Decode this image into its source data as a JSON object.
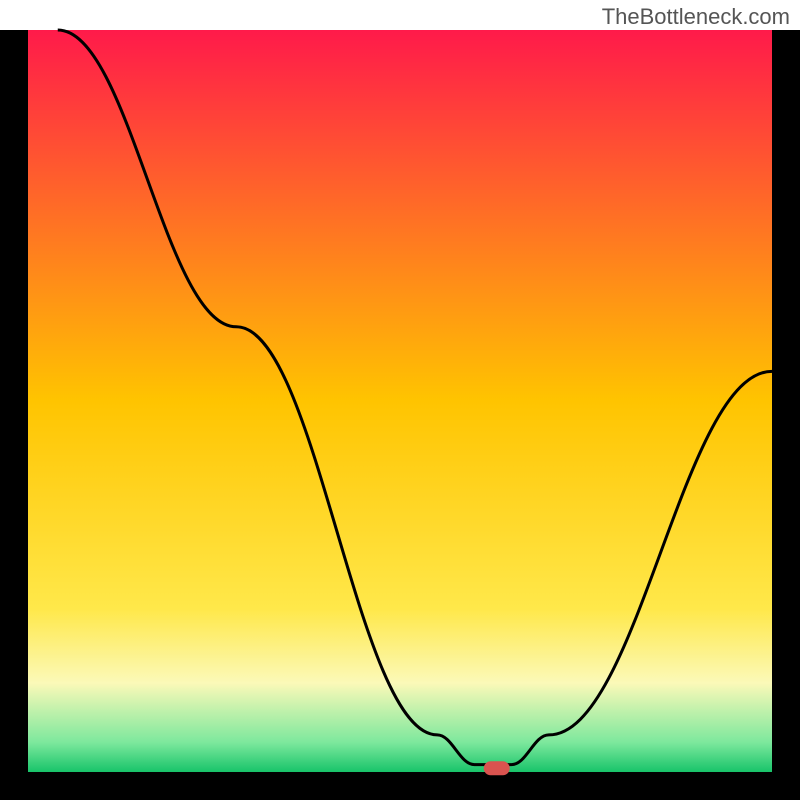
{
  "attribution": "TheBottleneck.com",
  "chart_data": {
    "type": "line",
    "title": "",
    "xlabel": "",
    "ylabel": "",
    "x_range": [
      0,
      100
    ],
    "y_range": [
      0,
      100
    ],
    "curve_points": [
      {
        "x": 4.0,
        "y": 100.0
      },
      {
        "x": 28.0,
        "y": 60.0
      },
      {
        "x": 55.0,
        "y": 5.0
      },
      {
        "x": 60.0,
        "y": 1.0
      },
      {
        "x": 65.0,
        "y": 1.0
      },
      {
        "x": 70.0,
        "y": 5.0
      },
      {
        "x": 100.0,
        "y": 54.0
      }
    ],
    "marker": {
      "x": 63.0,
      "y": 0.5,
      "color": "#d9534f"
    },
    "gradient_stops": [
      {
        "offset": 0.0,
        "color": "#ff1a4a"
      },
      {
        "offset": 0.5,
        "color": "#ffc400"
      },
      {
        "offset": 0.78,
        "color": "#ffe84a"
      },
      {
        "offset": 0.88,
        "color": "#fbf9b8"
      },
      {
        "offset": 0.96,
        "color": "#7de89d"
      },
      {
        "offset": 1.0,
        "color": "#18c46a"
      }
    ],
    "frame_color": "#000000",
    "frame_thickness_px": 28
  }
}
